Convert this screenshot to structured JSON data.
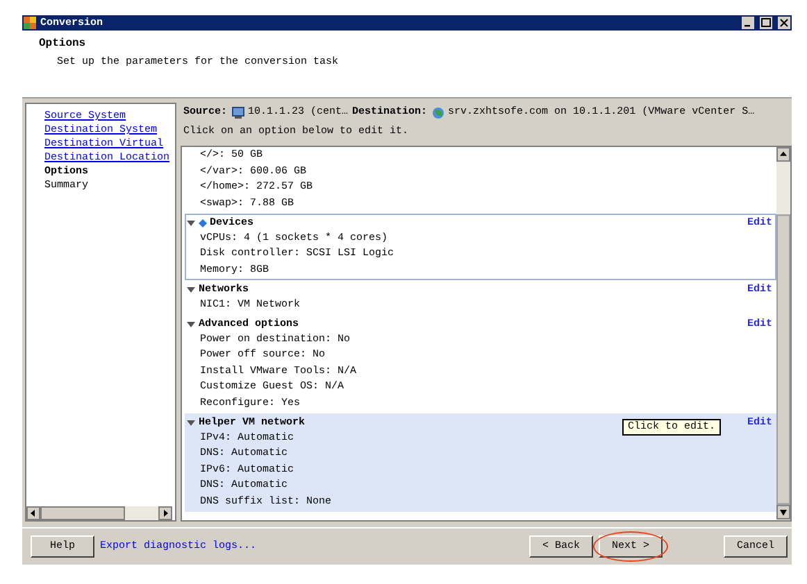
{
  "window": {
    "title": "Conversion"
  },
  "header": {
    "title": "Options",
    "subtitle": "Set up the parameters for the conversion task"
  },
  "nav": [
    {
      "label": "Source System",
      "kind": "link"
    },
    {
      "label": "Destination System",
      "kind": "link"
    },
    {
      "label": "Destination Virtual",
      "kind": "link"
    },
    {
      "label": "Destination Location",
      "kind": "link"
    },
    {
      "label": "Options",
      "kind": "current"
    },
    {
      "label": "Summary",
      "kind": "plain"
    }
  ],
  "summary_bar": {
    "source_label": "Source:",
    "source": "10.1.1.23 (cent…",
    "destination_label": "Destination:",
    "destination": "srv.zxhtsofe.com on 10.1.1.201 (VMware vCenter S…",
    "hint": "Click on an option below to edit it."
  },
  "sections": [
    {
      "selected": false,
      "highlighted": false,
      "items": [
        "</>: 50 GB",
        "</var>: 600.06 GB",
        "</home>: 272.57 GB",
        "<swap>: 7.88 GB"
      ]
    },
    {
      "title": "Devices",
      "edit": "Edit",
      "selected": true,
      "highlighted": false,
      "items": [
        "vCPUs: 4 (1 sockets * 4 cores)",
        "Disk controller: SCSI LSI Logic",
        "Memory: 8GB"
      ]
    },
    {
      "title": "Networks",
      "edit": "Edit",
      "selected": false,
      "highlighted": false,
      "items": [
        "NIC1: VM Network"
      ]
    },
    {
      "title": "Advanced options",
      "edit": "Edit",
      "selected": false,
      "highlighted": false,
      "items": [
        "Power on destination: No",
        "Power off source: No",
        "Install VMware Tools: N/A",
        "Customize Guest OS: N/A",
        "Reconfigure: Yes"
      ]
    },
    {
      "title": "Helper VM network",
      "edit": "Edit",
      "selected": false,
      "highlighted": true,
      "items": [
        "IPv4: Automatic",
        "DNS: Automatic",
        "IPv6: Automatic",
        "DNS: Automatic",
        "DNS suffix list: None"
      ]
    }
  ],
  "tooltip": "Click to edit.",
  "footer": {
    "help": "Help",
    "export_link": "Export diagnostic logs...",
    "buttons": [
      {
        "label": "< Back",
        "circled": false
      },
      {
        "label": "Next >",
        "circled": true
      },
      {
        "label": "Cancel",
        "circled": false
      }
    ]
  }
}
